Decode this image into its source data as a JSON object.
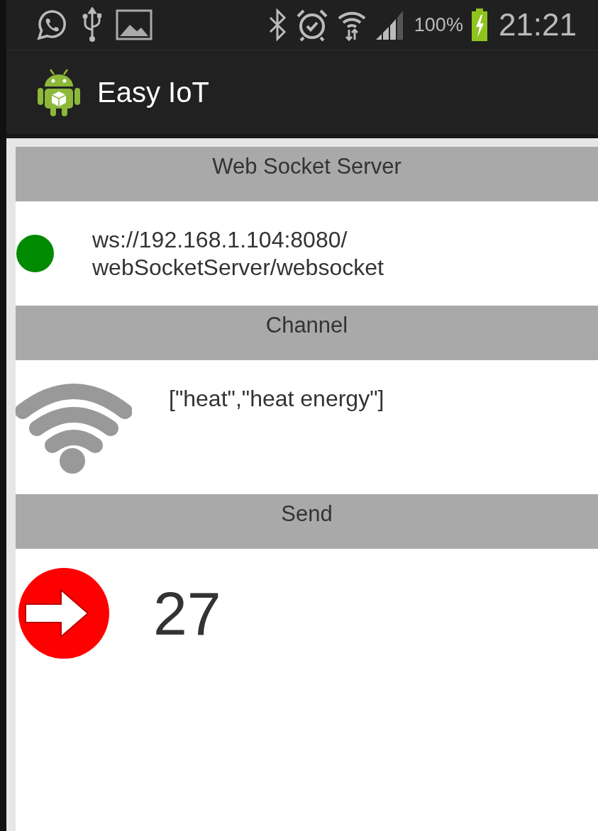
{
  "status_bar": {
    "battery": "100%",
    "time": "21:21"
  },
  "action_bar": {
    "title": "Easy IoT"
  },
  "sections": [
    {
      "kind": "server",
      "header": "Web Socket Server",
      "text": "ws://192.168.1.104:8080/\nwebSocketServer/websocket",
      "connected": true
    },
    {
      "kind": "channel",
      "header": "Channel",
      "text": "[\"heat\",\"heat energy\"]"
    },
    {
      "kind": "send",
      "header": "Send",
      "text": "27"
    }
  ]
}
